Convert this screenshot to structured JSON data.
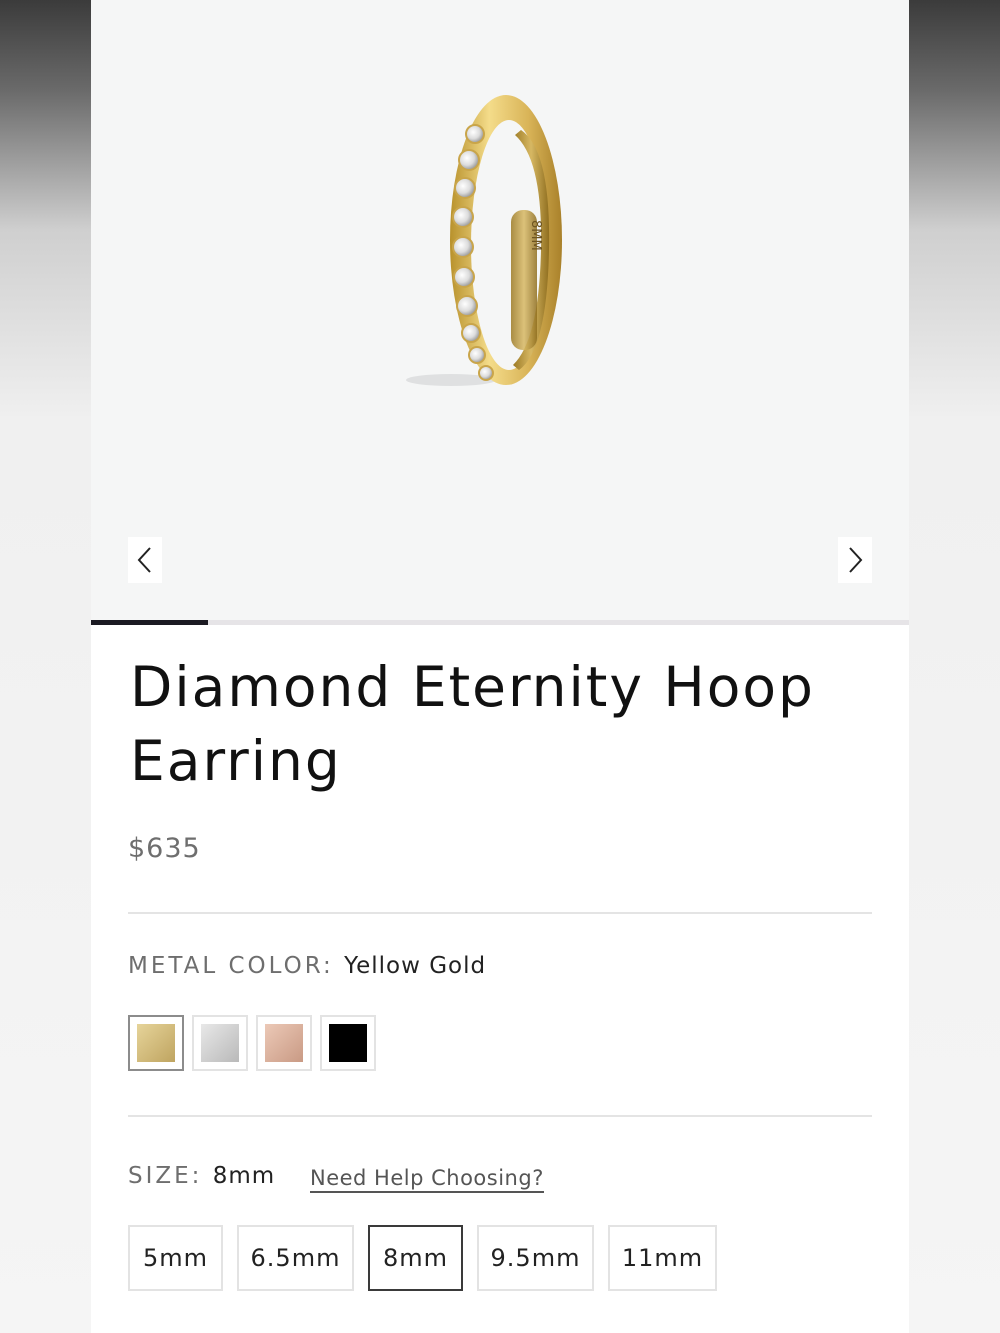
{
  "gallery": {
    "engraving": "8MM",
    "current_slide": 1,
    "total_slides": 7,
    "prev_icon": "chevron-left-icon",
    "next_icon": "chevron-right-icon"
  },
  "product": {
    "title_line1": "Diamond Eternity Hoop",
    "title_line2": "Earring",
    "price": "$635"
  },
  "metal": {
    "label": "METAL COLOR:",
    "value": "Yellow Gold",
    "options": [
      {
        "name": "Yellow Gold",
        "color_a": "#e6d49a",
        "color_b": "#bfa460",
        "selected": true
      },
      {
        "name": "White Gold",
        "color_a": "#e8e8e8",
        "color_b": "#b9b9b9",
        "selected": false
      },
      {
        "name": "Rose Gold",
        "color_a": "#ecc9b7",
        "color_b": "#c99a84",
        "selected": false
      },
      {
        "name": "Black",
        "color_a": "#000000",
        "color_b": "#000000",
        "selected": false
      }
    ]
  },
  "size": {
    "label": "SIZE:",
    "value": "8mm",
    "help_link": "Need Help Choosing?",
    "options": [
      "5mm",
      "6.5mm",
      "8mm",
      "9.5mm",
      "11mm"
    ],
    "selected_index": 2
  }
}
